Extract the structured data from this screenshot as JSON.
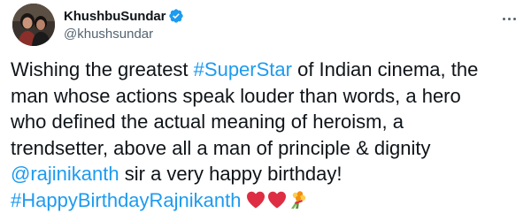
{
  "author": {
    "display_name": "KhushbuSundar",
    "handle": "@khushsundar",
    "verified": true,
    "avatar_icon": "profile-photo"
  },
  "more_icon": "more-horizontal-icon",
  "tweet": {
    "line1": {
      "pre": "Wishing the greatest ",
      "hashtag": "#SuperStar",
      "post": " of Indian cinema, the"
    },
    "line2": "man whose actions speak louder than words, a hero",
    "line3": "who defined the actual meaning of heroism, a",
    "line4": "trendsetter, above all a man of principle & dignity",
    "line5": {
      "mention": "@rajinikanth",
      "post": " sir a very happy birthday!"
    },
    "line6": {
      "hashtag": "#HappyBirthdayRajnikanth",
      "emojis": [
        "red-heart",
        "red-heart",
        "bouquet"
      ]
    }
  },
  "colors": {
    "link": "#1d9bf0",
    "text": "#0f1419",
    "secondary": "#536471",
    "verified": "#1d9bf0",
    "heart": "#dd2e44"
  }
}
